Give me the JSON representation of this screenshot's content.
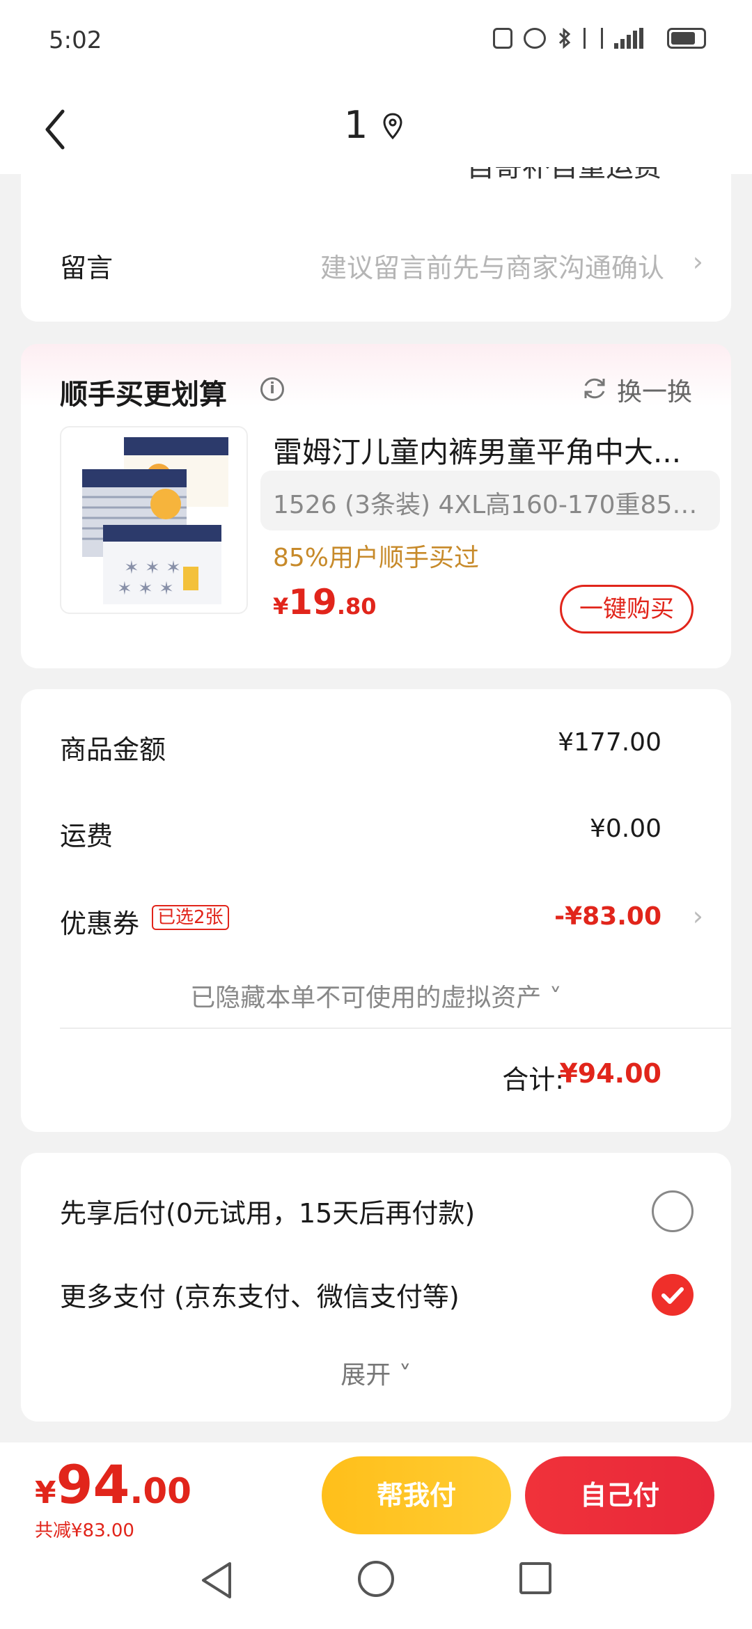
{
  "status_bar": {
    "time": "5:02"
  },
  "nav": {
    "title": "1"
  },
  "card_top": {
    "clipped_text": "自寄补自重运费",
    "message_label": "留言",
    "message_placeholder": "建议留言前先与商家沟通确认"
  },
  "recommend": {
    "title": "顺手买更划算",
    "info_glyph": "i",
    "swap_label": "换一换",
    "product_title": "雷姆汀儿童内裤男童平角中大...",
    "sku": "1526 (3条装)   4XL高160-170重85-1...",
    "promo": "85%用户顺手买过",
    "price_currency": "¥",
    "price_int": "19",
    "price_dec": ".80",
    "buy_label": "一键购买"
  },
  "amounts": {
    "goods_label": "商品金额",
    "goods_value": "¥177.00",
    "shipping_label": "运费",
    "shipping_value": "¥0.00",
    "coupon_label": "优惠券",
    "coupon_badge": "已选2张",
    "coupon_value": "-¥83.00",
    "hidden_assets": "已隐藏本单不可使用的虚拟资产 ˅",
    "total_label": "合计:",
    "total_value": "¥94.00"
  },
  "payment": {
    "option1": "先享后付(0元试用，15天后再付款)",
    "option2": "更多支付 (京东支付、微信支付等)",
    "option1_checked": false,
    "option2_checked": true,
    "expand": "展开 ˅"
  },
  "bottom": {
    "currency": "¥",
    "price_int": "94",
    "price_dec": ".00",
    "saved": "共减¥83.00",
    "help_pay": "帮我付",
    "self_pay": "自己付"
  },
  "colors": {
    "accent_red": "#e1251b",
    "help_yellow": "#ffc21f",
    "promo_gold": "#c78a2a"
  }
}
